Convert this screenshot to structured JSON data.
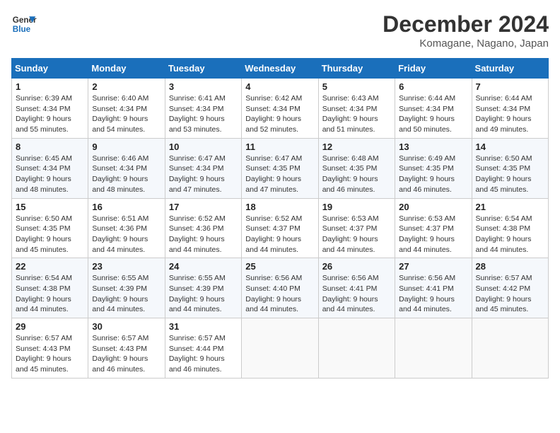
{
  "header": {
    "logo_line1": "General",
    "logo_line2": "Blue",
    "month_title": "December 2024",
    "location": "Komagane, Nagano, Japan"
  },
  "weekdays": [
    "Sunday",
    "Monday",
    "Tuesday",
    "Wednesday",
    "Thursday",
    "Friday",
    "Saturday"
  ],
  "weeks": [
    [
      {
        "day": "1",
        "sunrise": "6:39 AM",
        "sunset": "4:34 PM",
        "daylight": "9 hours and 55 minutes."
      },
      {
        "day": "2",
        "sunrise": "6:40 AM",
        "sunset": "4:34 PM",
        "daylight": "9 hours and 54 minutes."
      },
      {
        "day": "3",
        "sunrise": "6:41 AM",
        "sunset": "4:34 PM",
        "daylight": "9 hours and 53 minutes."
      },
      {
        "day": "4",
        "sunrise": "6:42 AM",
        "sunset": "4:34 PM",
        "daylight": "9 hours and 52 minutes."
      },
      {
        "day": "5",
        "sunrise": "6:43 AM",
        "sunset": "4:34 PM",
        "daylight": "9 hours and 51 minutes."
      },
      {
        "day": "6",
        "sunrise": "6:44 AM",
        "sunset": "4:34 PM",
        "daylight": "9 hours and 50 minutes."
      },
      {
        "day": "7",
        "sunrise": "6:44 AM",
        "sunset": "4:34 PM",
        "daylight": "9 hours and 49 minutes."
      }
    ],
    [
      {
        "day": "8",
        "sunrise": "6:45 AM",
        "sunset": "4:34 PM",
        "daylight": "9 hours and 48 minutes."
      },
      {
        "day": "9",
        "sunrise": "6:46 AM",
        "sunset": "4:34 PM",
        "daylight": "9 hours and 48 minutes."
      },
      {
        "day": "10",
        "sunrise": "6:47 AM",
        "sunset": "4:34 PM",
        "daylight": "9 hours and 47 minutes."
      },
      {
        "day": "11",
        "sunrise": "6:47 AM",
        "sunset": "4:35 PM",
        "daylight": "9 hours and 47 minutes."
      },
      {
        "day": "12",
        "sunrise": "6:48 AM",
        "sunset": "4:35 PM",
        "daylight": "9 hours and 46 minutes."
      },
      {
        "day": "13",
        "sunrise": "6:49 AM",
        "sunset": "4:35 PM",
        "daylight": "9 hours and 46 minutes."
      },
      {
        "day": "14",
        "sunrise": "6:50 AM",
        "sunset": "4:35 PM",
        "daylight": "9 hours and 45 minutes."
      }
    ],
    [
      {
        "day": "15",
        "sunrise": "6:50 AM",
        "sunset": "4:35 PM",
        "daylight": "9 hours and 45 minutes."
      },
      {
        "day": "16",
        "sunrise": "6:51 AM",
        "sunset": "4:36 PM",
        "daylight": "9 hours and 44 minutes."
      },
      {
        "day": "17",
        "sunrise": "6:52 AM",
        "sunset": "4:36 PM",
        "daylight": "9 hours and 44 minutes."
      },
      {
        "day": "18",
        "sunrise": "6:52 AM",
        "sunset": "4:37 PM",
        "daylight": "9 hours and 44 minutes."
      },
      {
        "day": "19",
        "sunrise": "6:53 AM",
        "sunset": "4:37 PM",
        "daylight": "9 hours and 44 minutes."
      },
      {
        "day": "20",
        "sunrise": "6:53 AM",
        "sunset": "4:37 PM",
        "daylight": "9 hours and 44 minutes."
      },
      {
        "day": "21",
        "sunrise": "6:54 AM",
        "sunset": "4:38 PM",
        "daylight": "9 hours and 44 minutes."
      }
    ],
    [
      {
        "day": "22",
        "sunrise": "6:54 AM",
        "sunset": "4:38 PM",
        "daylight": "9 hours and 44 minutes."
      },
      {
        "day": "23",
        "sunrise": "6:55 AM",
        "sunset": "4:39 PM",
        "daylight": "9 hours and 44 minutes."
      },
      {
        "day": "24",
        "sunrise": "6:55 AM",
        "sunset": "4:39 PM",
        "daylight": "9 hours and 44 minutes."
      },
      {
        "day": "25",
        "sunrise": "6:56 AM",
        "sunset": "4:40 PM",
        "daylight": "9 hours and 44 minutes."
      },
      {
        "day": "26",
        "sunrise": "6:56 AM",
        "sunset": "4:41 PM",
        "daylight": "9 hours and 44 minutes."
      },
      {
        "day": "27",
        "sunrise": "6:56 AM",
        "sunset": "4:41 PM",
        "daylight": "9 hours and 44 minutes."
      },
      {
        "day": "28",
        "sunrise": "6:57 AM",
        "sunset": "4:42 PM",
        "daylight": "9 hours and 45 minutes."
      }
    ],
    [
      {
        "day": "29",
        "sunrise": "6:57 AM",
        "sunset": "4:43 PM",
        "daylight": "9 hours and 45 minutes."
      },
      {
        "day": "30",
        "sunrise": "6:57 AM",
        "sunset": "4:43 PM",
        "daylight": "9 hours and 46 minutes."
      },
      {
        "day": "31",
        "sunrise": "6:57 AM",
        "sunset": "4:44 PM",
        "daylight": "9 hours and 46 minutes."
      },
      null,
      null,
      null,
      null
    ]
  ]
}
